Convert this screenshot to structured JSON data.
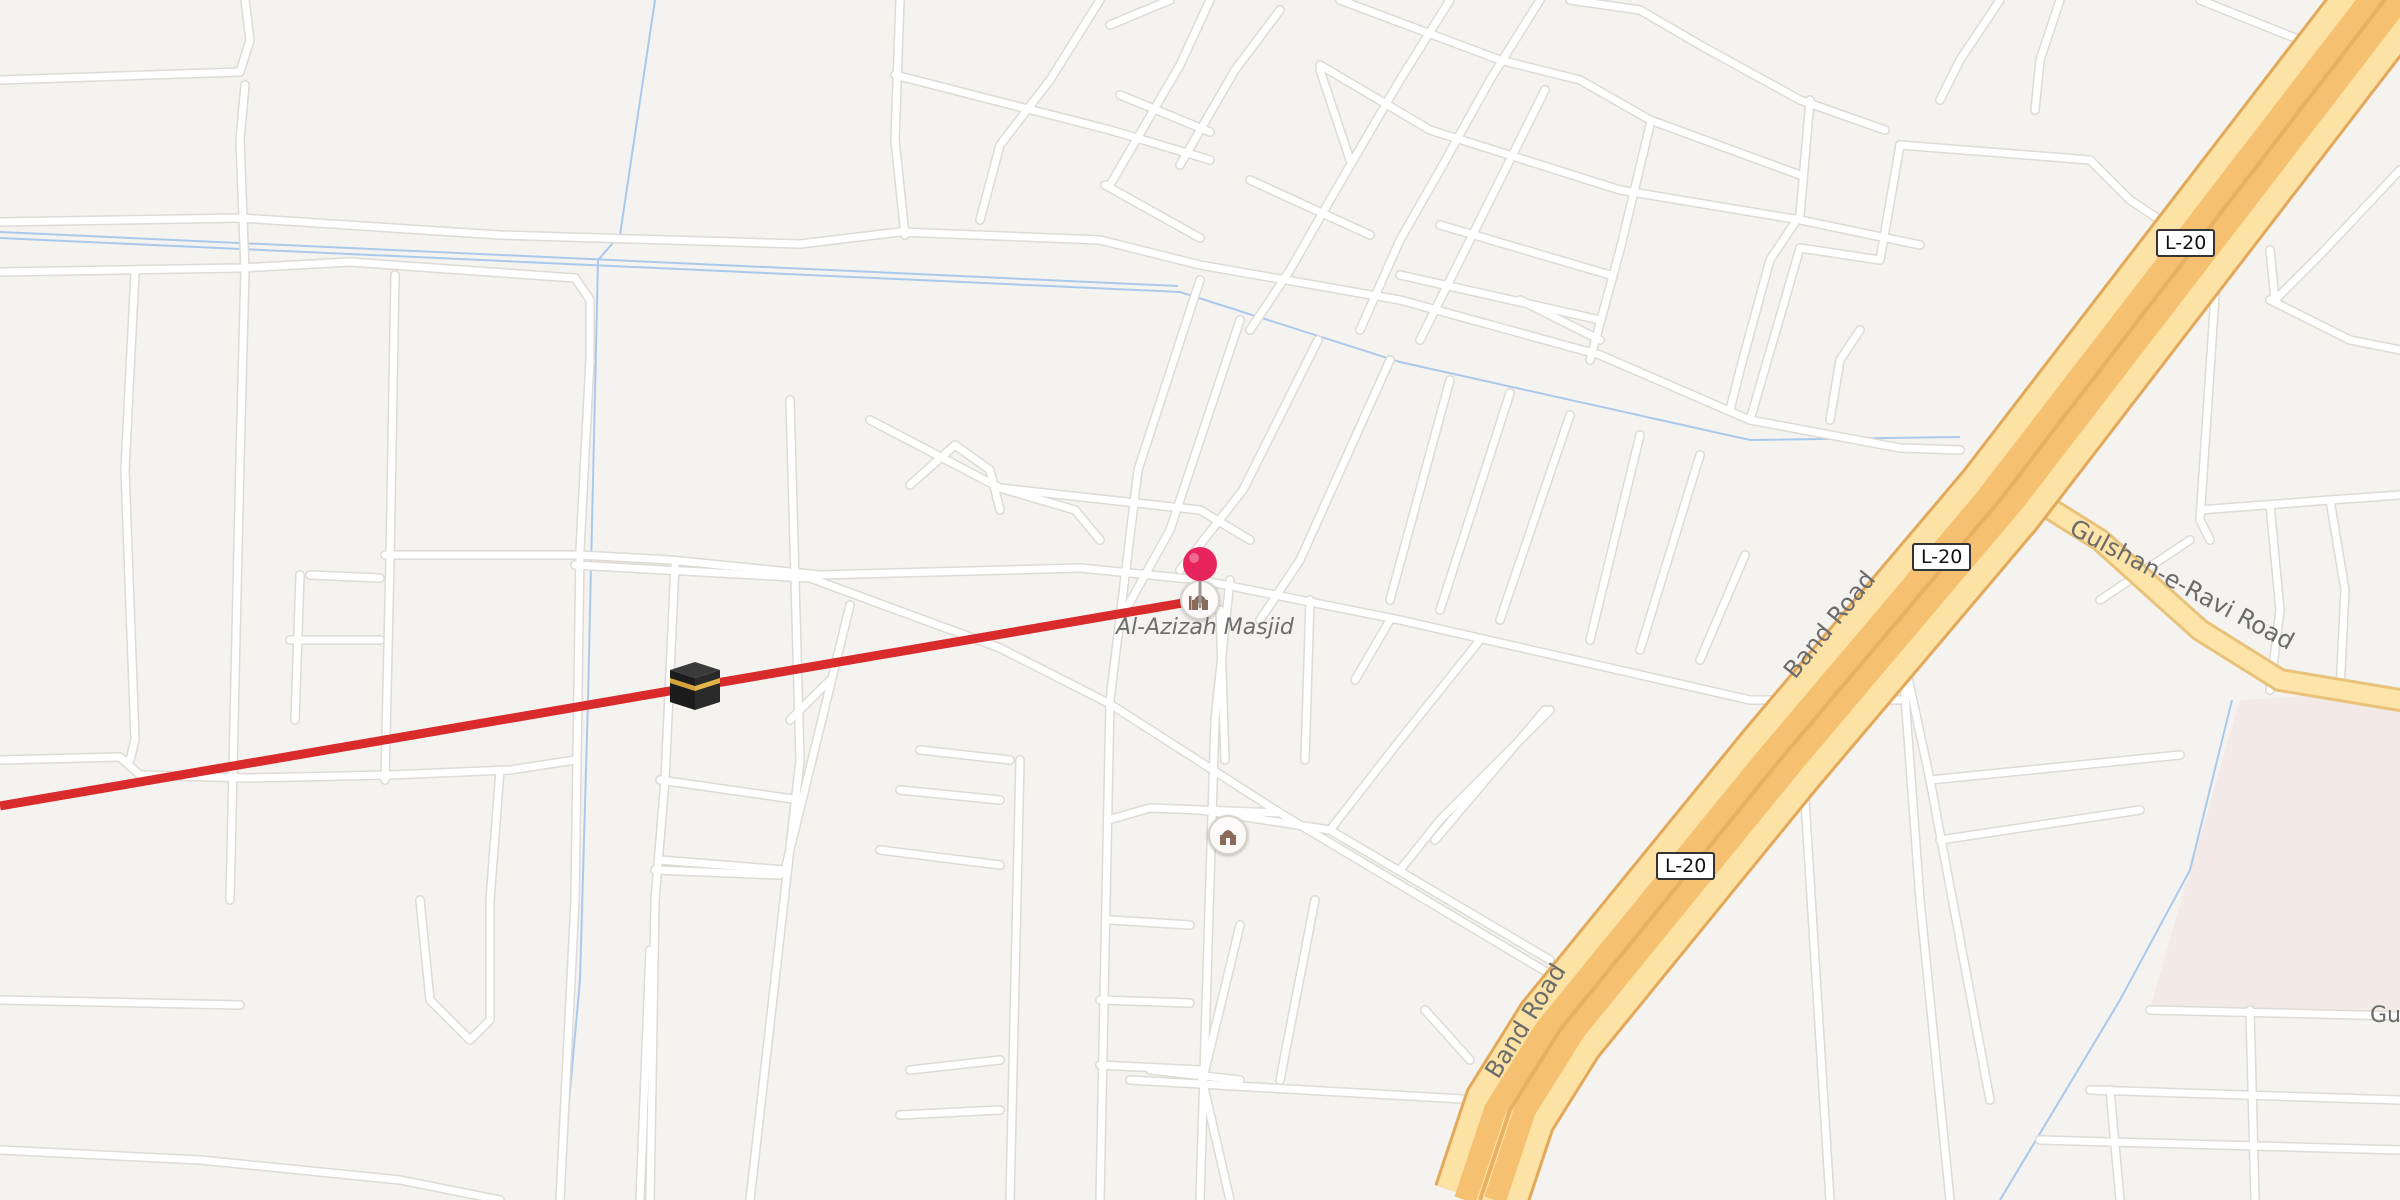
{
  "map": {
    "colors": {
      "background": "#f5f3f0",
      "street": "#ffffff",
      "highway": "#f7c97a",
      "highway_edge": "#e3a85a",
      "secondary_road": "#fde4a8",
      "canal": "#a9c9ec",
      "qibla_line": "#d92b2b",
      "pin": "#e8245c"
    },
    "labels": {
      "mosque": "Al-Azizah Masjid",
      "band_road_1": "Band Road",
      "band_road_2": "Band Road",
      "gulshan": "Gulshan-e-Ravi Road",
      "edge_fragment": "Gu"
    },
    "shields": [
      "L-20",
      "L-20",
      "L-20"
    ],
    "icons": {
      "pin": "location-pin-icon",
      "kaaba": "kaaba-icon",
      "mosque": "mosque-icon"
    }
  }
}
